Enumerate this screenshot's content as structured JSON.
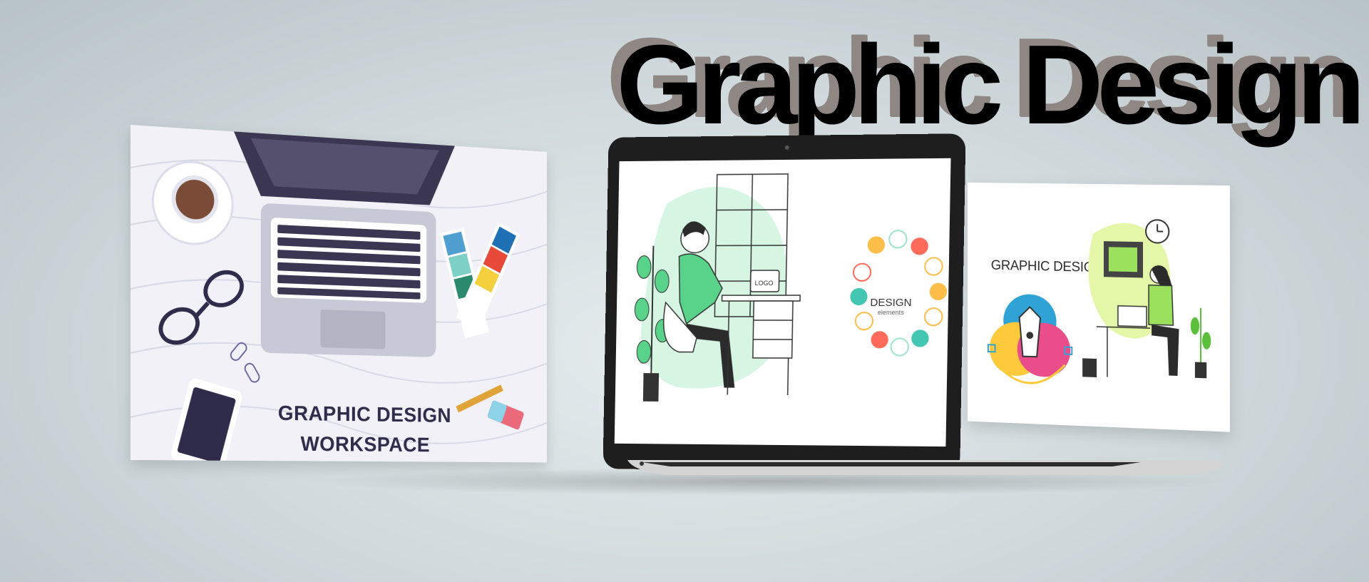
{
  "headline": "Graphic Design",
  "left_card": {
    "title_line1": "GRAPHIC DESIGN",
    "title_line2": "WORKSPACE"
  },
  "laptop_screen": {
    "title": "DESIGN",
    "subtitle": "elements",
    "logo_text": "LOGO"
  },
  "right_card": {
    "title": "GRAPHIC DESIGN"
  },
  "colors": {
    "headline": "#000000",
    "headline_shadow": "#8f8784",
    "accent_green": "#5ad38a",
    "accent_lime": "#d9f27a",
    "dark_navy": "#2f2b4a"
  }
}
